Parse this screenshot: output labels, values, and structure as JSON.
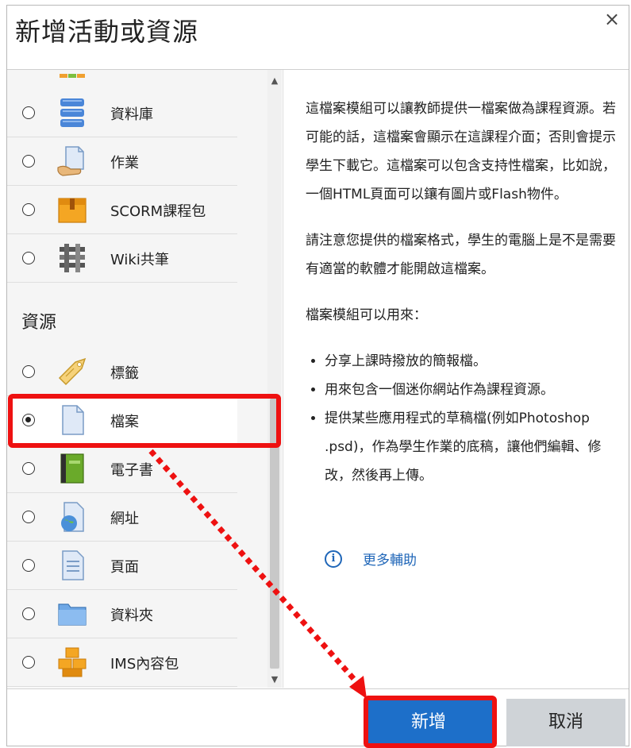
{
  "dialog": {
    "title": "新增活動或資源",
    "close_icon": "×"
  },
  "activities": [
    {
      "label": "資料庫",
      "icon": "database-icon",
      "selected": false
    },
    {
      "label": "作業",
      "icon": "assignment-icon",
      "selected": false
    },
    {
      "label": "SCORM課程包",
      "icon": "scorm-package-icon",
      "selected": false
    },
    {
      "label": "Wiki共筆",
      "icon": "wiki-icon",
      "selected": false
    }
  ],
  "resources_heading": "資源",
  "resources": [
    {
      "label": "標籤",
      "icon": "label-tag-icon",
      "selected": false
    },
    {
      "label": "檔案",
      "icon": "file-icon",
      "selected": true
    },
    {
      "label": "電子書",
      "icon": "book-icon",
      "selected": false
    },
    {
      "label": "網址",
      "icon": "url-icon",
      "selected": false
    },
    {
      "label": "頁面",
      "icon": "page-icon",
      "selected": false
    },
    {
      "label": "資料夾",
      "icon": "folder-icon",
      "selected": false
    },
    {
      "label": "IMS內容包",
      "icon": "ims-package-icon",
      "selected": false
    }
  ],
  "description": {
    "p1": "這檔案模組可以讓教師提供一檔案做為課程資源。若可能的話，這檔案會顯示在這課程介面；否則會提示學生下載它。這檔案可以包含支持性檔案，比如說，一個HTML頁面可以鑲有圖片或Flash物件。",
    "p2": "請注意您提供的檔案格式，學生的電腦上是不是需要有適當的軟體才能開啟這檔案。",
    "p3": "檔案模組可以用來：",
    "bullets": [
      "分享上課時撥放的簡報檔。",
      "用來包含一個迷你網站作為課程資源。",
      "提供某些應用程式的草稿檔(例如Photoshop .psd)，作為學生作業的底稿，讓他們編輯、修改，然後再上傳。"
    ],
    "help_link": "更多輔助"
  },
  "buttons": {
    "add": "新增",
    "cancel": "取消"
  },
  "colors": {
    "primary": "#1d6fc9",
    "annotation": "#ee1111"
  }
}
